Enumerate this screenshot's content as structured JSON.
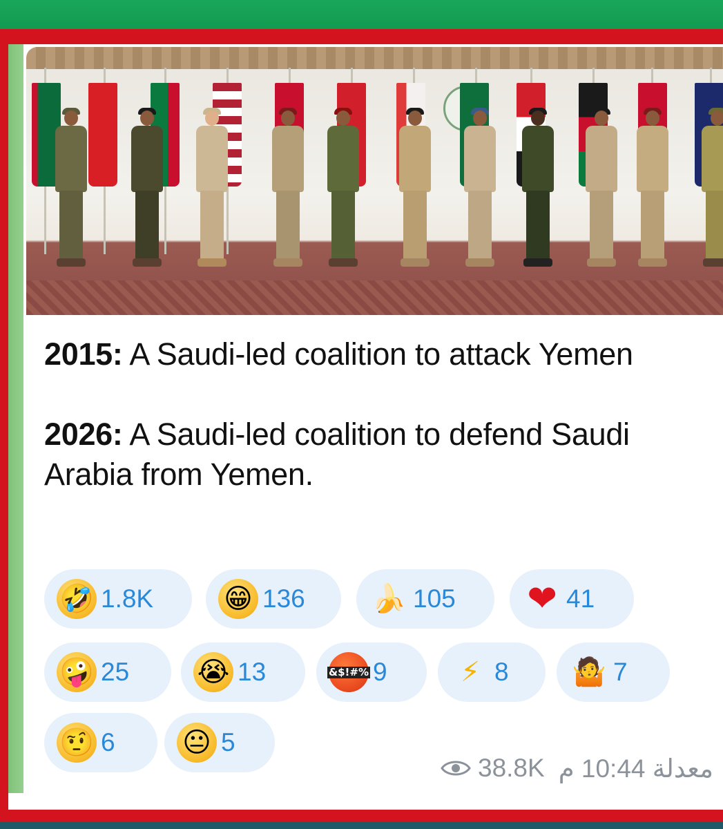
{
  "post": {
    "line1_year": "2015:",
    "line1_text": " A Saudi-led coalition to attack Yemen",
    "line2_year": "2026:",
    "line2_text": " A Saudi-led coalition to defend Saudi Arabia from Yemen."
  },
  "reactions": [
    {
      "emoji": "rolling-on-floor-laughing",
      "glyph": "🤣",
      "count": "1.8K"
    },
    {
      "emoji": "grinning-face",
      "glyph": "😁",
      "count": "136"
    },
    {
      "emoji": "banana",
      "glyph": "🍌",
      "count": "105"
    },
    {
      "emoji": "red-heart",
      "glyph": "❤",
      "count": "41"
    },
    {
      "emoji": "zany-face",
      "glyph": "🤪",
      "count": "25"
    },
    {
      "emoji": "loudly-crying-face",
      "glyph": "😭",
      "count": "13"
    },
    {
      "emoji": "face-with-symbols-on-mouth",
      "glyph": "&$!#%",
      "count": "9"
    },
    {
      "emoji": "high-voltage",
      "glyph": "⚡",
      "count": "8"
    },
    {
      "emoji": "person-shrugging",
      "glyph": "🤷",
      "count": "7"
    },
    {
      "emoji": "face-with-raised-eyebrow",
      "glyph": "🤨",
      "count": "6"
    },
    {
      "emoji": "neutral-face",
      "glyph": "😐",
      "count": "5"
    }
  ],
  "footer": {
    "views": "38.8K",
    "time": "معدلة 10:44 م"
  },
  "colors": {
    "reaction_bg": "#e7f1fb",
    "reaction_count": "#2a88d8",
    "frame_red": "#d3141f",
    "frame_green": "#119b50"
  }
}
